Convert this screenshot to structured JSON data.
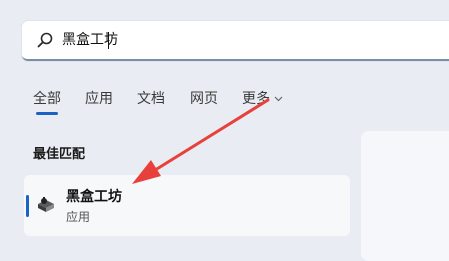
{
  "search": {
    "value": "黑盒工坊",
    "icon": "search-icon"
  },
  "tabs": [
    {
      "label": "全部",
      "active": true
    },
    {
      "label": "应用",
      "active": false
    },
    {
      "label": "文档",
      "active": false
    },
    {
      "label": "网页",
      "active": false
    },
    {
      "label": "更多",
      "active": false
    }
  ],
  "best_match": {
    "heading": "最佳匹配",
    "result": {
      "name": "黑盒工坊",
      "type": "应用",
      "icon": "app-icon"
    }
  },
  "colors": {
    "accent": "#1a63c5",
    "annotation_arrow": "#e8413b",
    "background": "#e9edf3"
  }
}
